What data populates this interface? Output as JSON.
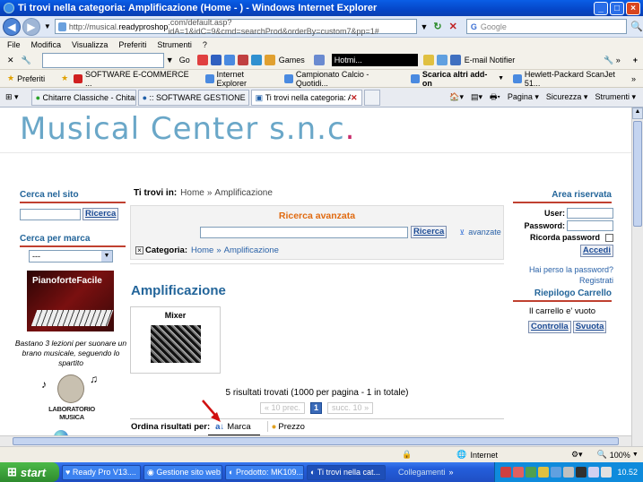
{
  "window": {
    "title": "Ti trovi nella categoria: Amplificazione (Home - ) - Windows Internet Explorer"
  },
  "address": {
    "url_prefix": "http://musical.",
    "url_host": "readyproshop",
    "url_rest": ".com/default.asp?idA=1&idC=9&cmd=searchProd&orderBy=custom7&pp=1#",
    "search_placeholder": "Google"
  },
  "menu": [
    "File",
    "Modifica",
    "Visualizza",
    "Preferiti",
    "Strumenti",
    "?"
  ],
  "toolbar": {
    "go": "Go",
    "games": "Games",
    "hotmail": "Hotmi...",
    "email": "E-mail Notifier"
  },
  "favorites": {
    "label": "Preferiti",
    "items": [
      "SOFTWARE E-COMMERCE ...",
      "Internet Explorer",
      "Campionato Calcio - Quotidi...",
      "Scarica altri add-on",
      "Hewlett-Packard ScanJet 51..."
    ]
  },
  "tabs": [
    "Chitarre Classiche - Chitarre ...",
    ":: SOFTWARE GESTIONE MA...",
    "Ti trovi nella categoria: A..."
  ],
  "commands": [
    "Pagina",
    "Sicurezza",
    "Strumenti"
  ],
  "site": {
    "logo": "Musical Center s.n.c",
    "logo_dot": ".",
    "left": {
      "search_head": "Cerca nel sito",
      "search_btn": "Ricerca",
      "brand_head": "Cerca per marca",
      "brand_sel": "---",
      "promo_title": "PianoforteFacile",
      "promo_text": "Bastano 3 lezioni per suonare un brano musicale, seguendo lo spartito",
      "lab_text": "LABORATORIO MUSICA"
    },
    "center": {
      "bc_label": "Ti trovi in:",
      "bc_home": "Home",
      "bc_sep": "»",
      "bc_cat": "Amplificazione",
      "adv_title": "Ricerca avanzata",
      "adv_btn": "Ricerca",
      "adv_link": "avanzate",
      "cat_label": "Categoria:",
      "cat_home": "Home",
      "cat_sep": "»",
      "cat_name": "Amplificazione",
      "heading": "Amplificazione",
      "product": "Mixer",
      "results": "5 risultati trovati (1000 per pagina - 1 in totale)",
      "prev": "« 10 prec.",
      "page": "1",
      "next": "succ. 10 »",
      "order_label": "Ordina risultati per:",
      "order_brand": "Marca",
      "order_price": "Prezzo"
    },
    "right": {
      "area_head": "Area riservata",
      "user_label": "User:",
      "pw_label": "Password:",
      "remember": "Ricorda password",
      "login_btn": "Accedi",
      "forgot": "Hai perso la password?",
      "register": "Registrati",
      "cart_head": "Riepilogo Carrello",
      "cart_text": "Il carrello e' vuoto",
      "check_btn": "Controlla",
      "empty_btn": "Svuota"
    }
  },
  "status": {
    "zone": "Internet",
    "zoom": "100%"
  },
  "taskbar": {
    "start": "start",
    "items": [
      "Ready Pro V13....",
      "Gestione sito web",
      "Prodotto: MK109...",
      "Ti trovi nella cat..."
    ],
    "collegamenti": "Collegamenti",
    "clock": "10.52"
  }
}
